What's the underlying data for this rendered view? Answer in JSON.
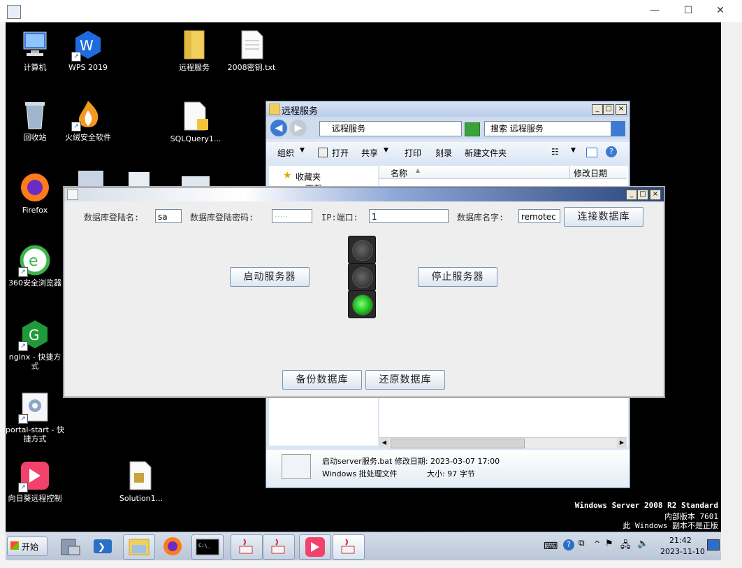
{
  "host": {
    "minimize": "—",
    "maximize": "☐",
    "close": "✕"
  },
  "desktop_icons": [
    {
      "id": "computer",
      "label": "计算机"
    },
    {
      "id": "wps",
      "label": "WPS 2019"
    },
    {
      "id": "remote-folder",
      "label": "远程服务"
    },
    {
      "id": "key-txt",
      "label": "2008密钥.txt"
    },
    {
      "id": "recycle",
      "label": "回收站"
    },
    {
      "id": "huorong",
      "label": "火绒安全软件"
    },
    {
      "id": "sqlquery",
      "label": "SQLQuery1..."
    },
    {
      "id": "firefox",
      "label": "Firefox"
    },
    {
      "id": "ie360",
      "label": "360安全浏览器"
    },
    {
      "id": "nginx",
      "label": "nginx - 快捷方式"
    },
    {
      "id": "portal",
      "label": "portal-start - 快捷方式"
    },
    {
      "id": "sunlogin",
      "label": "向日葵远程控制"
    },
    {
      "id": "solution",
      "label": "Solution1..."
    }
  ],
  "explorer": {
    "title": "远程服务",
    "address": "远程服务",
    "search_placeholder": "搜索 远程服务",
    "toolbar": [
      "组织",
      "打开",
      "共享",
      "打印",
      "刻录",
      "新建文件夹"
    ],
    "nav_favorites": "收藏夹",
    "nav_downloads": "下载",
    "columns": {
      "name": "名称",
      "modified": "修改日期"
    },
    "details": {
      "filename_line": "启动server服务.bat  修改日期: 2023-03-07 17:00",
      "type_line": "Windows 批处理文件",
      "size_line": "大小: 97 字节"
    }
  },
  "app": {
    "db_user_label": "数据库登陆名:",
    "db_user_value": "sa",
    "db_password_label": "数据库登陆密码:",
    "db_password_value": "·····",
    "ip_port_label": "IP:端口:",
    "ip_port_value": "1",
    "db_name_label": "数据库名字:",
    "db_name_value": "remotec",
    "connect_button": "连接数据库",
    "start_button": "启动服务器",
    "stop_button": "停止服务器",
    "backup_button": "备份数据库",
    "restore_button": "还原数据库",
    "traffic_light_state": "green"
  },
  "watermark": {
    "edition": "Windows Server 2008 R2 Standard",
    "build": "内部版本 7601",
    "notice": "此 Windows 副本不是正版"
  },
  "taskbar": {
    "start_label": "开始",
    "time": "21:42",
    "date": "2023-11-10"
  },
  "colors": {
    "accent": "#28447a",
    "lamp_on": "#1ec21e",
    "desktop": "#000000"
  }
}
